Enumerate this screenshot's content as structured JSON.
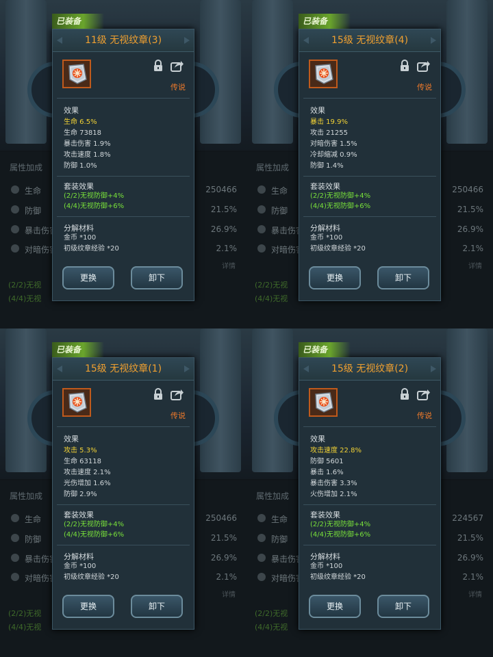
{
  "common": {
    "tag_label": "已装备",
    "rarity": "传说",
    "effects_title": "效果",
    "set_title": "套装效果",
    "set_bonus": [
      "(2/2)无视防御+4%",
      "(4/4)无视防御+6%"
    ],
    "materials_title": "分解材料",
    "materials": [
      "金币 *100",
      "初级纹章经验 *20"
    ],
    "replace_label": "更换",
    "unequip_label": "卸下",
    "bg_section": "属性加成",
    "bg_detail": "详情",
    "bg_set": [
      "(2/2)无视",
      "(4/4)无视"
    ],
    "bg_stat_names": [
      "生命",
      "防御",
      "暴击伤害",
      "对暗伤害"
    ],
    "colors": {
      "title": "#f0a030",
      "main_stat": "#f2d235",
      "set_bonus": "#78e03a",
      "rarity": "#f07a2a"
    }
  },
  "panels": [
    {
      "title": "11级 无视纹章(3)",
      "effects": [
        "生命 6.5%",
        "生命 73818",
        "暴击伤害 1.9%",
        "攻击速度 1.8%",
        "防御 1.0%"
      ],
      "bg_values": [
        "250466",
        "21.5%",
        "26.9%",
        "2.1%"
      ]
    },
    {
      "title": "15级 无视纹章(4)",
      "effects": [
        "暴击 19.9%",
        "攻击 21255",
        "对暗伤害 1.5%",
        "冷却缩减 0.9%",
        "防御 1.4%"
      ],
      "bg_values": [
        "250466",
        "21.5%",
        "26.9%",
        "2.1%"
      ]
    },
    {
      "title": "15级 无视纹章(1)",
      "effects": [
        "攻击 5.3%",
        "生命 63118",
        "攻击速度 2.1%",
        "光伤增加 1.6%",
        "防御 2.9%"
      ],
      "bg_values": [
        "250466",
        "21.5%",
        "26.9%",
        "2.1%"
      ]
    },
    {
      "title": "15级 无视纹章(2)",
      "effects": [
        "攻击速度 22.8%",
        "防御 5601",
        "暴击 1.6%",
        "暴击伤害 3.3%",
        "火伤增加 2.1%"
      ],
      "bg_values": [
        "224567",
        "21.5%",
        "26.9%",
        "2.1%"
      ]
    }
  ]
}
